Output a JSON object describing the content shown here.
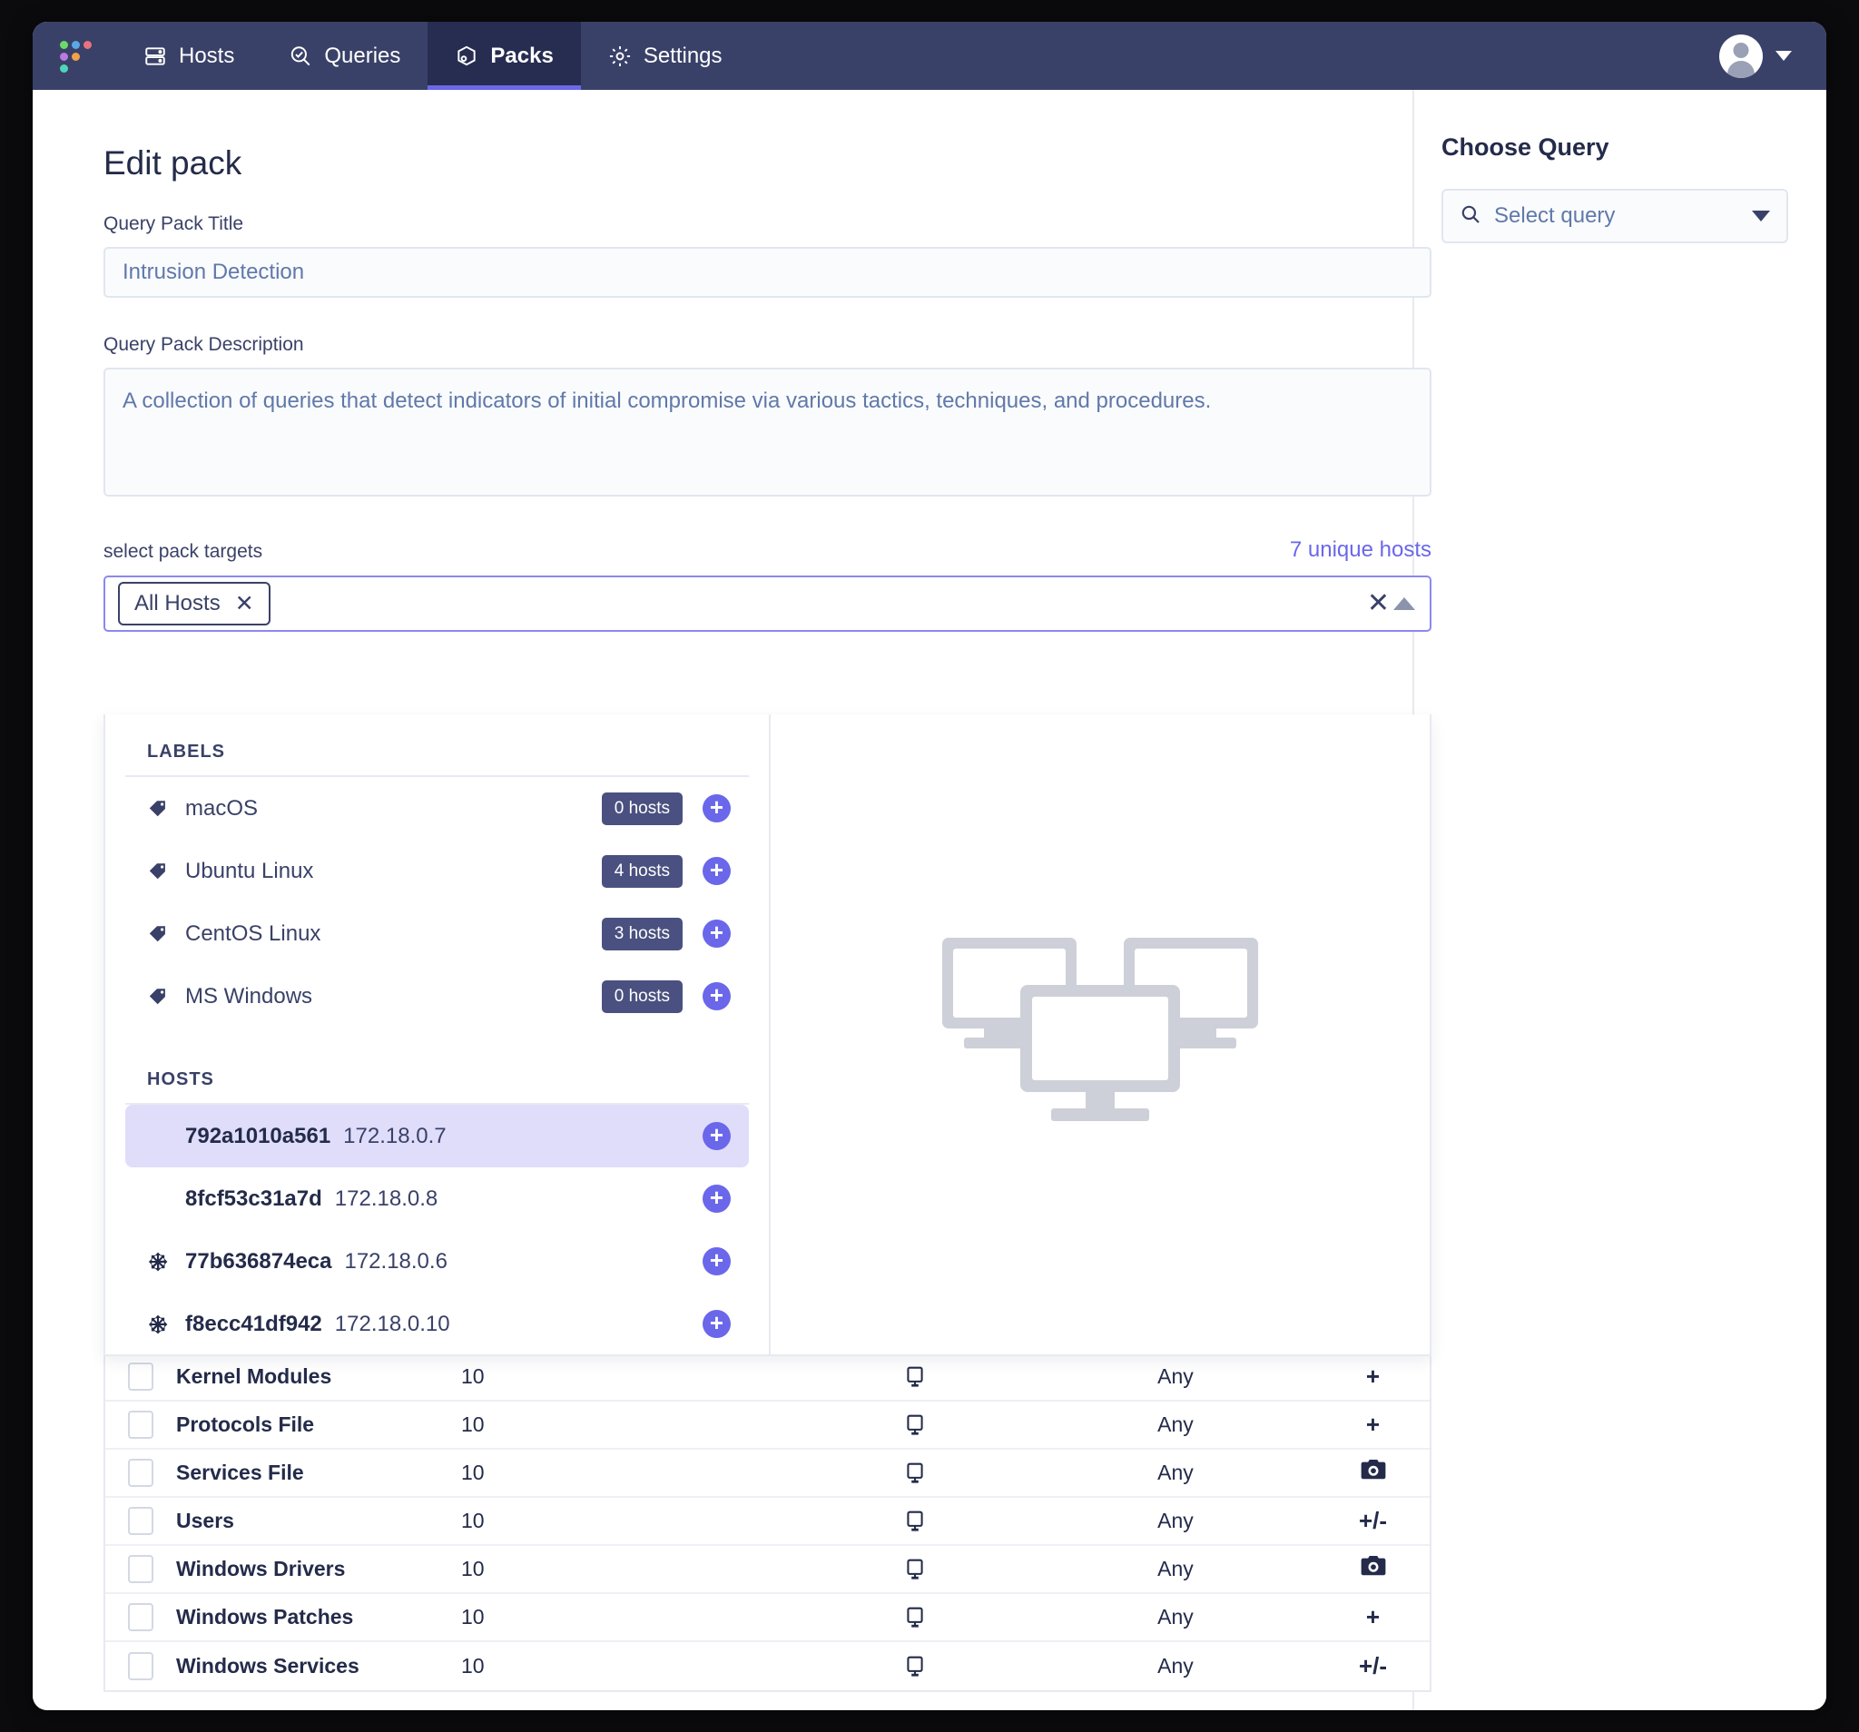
{
  "nav": {
    "logo_name": "fleet-dots-logo",
    "items": [
      {
        "label": "Hosts",
        "icon": "server-icon",
        "active": false
      },
      {
        "label": "Queries",
        "icon": "magnifier-check-icon",
        "active": false
      },
      {
        "label": "Packs",
        "icon": "pack-box-icon",
        "active": true
      },
      {
        "label": "Settings",
        "icon": "gear-icon",
        "active": false
      }
    ],
    "avatar_icon": "user-avatar",
    "avatar_caret_icon": "chevron-down-icon"
  },
  "page": {
    "title": "Edit pack",
    "title_field": {
      "label": "Query Pack Title",
      "value": "Intrusion Detection"
    },
    "description_field": {
      "label": "Query Pack Description",
      "value": "A collection of queries that detect indicators of initial compromise via various tactics, techniques, and procedures."
    },
    "targets": {
      "label": "select pack targets",
      "unique_hosts": "7 unique hosts",
      "chips": [
        {
          "label": "All Hosts",
          "remove_icon": "close-icon"
        }
      ],
      "clear_icon": "close-icon",
      "collapse_icon": "chevron-up-icon"
    }
  },
  "dropdown": {
    "labels_header": "LABELS",
    "labels": [
      {
        "name": "macOS",
        "count": "0 hosts",
        "icon": "tag-icon",
        "add_icon": "plus-circle-icon"
      },
      {
        "name": "Ubuntu Linux",
        "count": "4 hosts",
        "icon": "tag-icon",
        "add_icon": "plus-circle-icon"
      },
      {
        "name": "CentOS Linux",
        "count": "3 hosts",
        "icon": "tag-icon",
        "add_icon": "plus-circle-icon"
      },
      {
        "name": "MS Windows",
        "count": "0 hosts",
        "icon": "tag-icon",
        "add_icon": "plus-circle-icon"
      }
    ],
    "hosts_header": "HOSTS",
    "hosts": [
      {
        "id": "792a1010a561",
        "ip": "172.18.0.7",
        "os_icon": "none",
        "selected": true,
        "add_icon": "plus-circle-icon"
      },
      {
        "id": "8fcf53c31a7d",
        "ip": "172.18.0.8",
        "os_icon": "none",
        "selected": false,
        "add_icon": "plus-circle-icon"
      },
      {
        "id": "77b636874eca",
        "ip": "172.18.0.6",
        "os_icon": "centos-icon",
        "selected": false,
        "add_icon": "plus-circle-icon"
      },
      {
        "id": "f8ecc41df942",
        "ip": "172.18.0.10",
        "os_icon": "centos-icon",
        "selected": false,
        "add_icon": "plus-circle-icon"
      }
    ],
    "preview_icon": "monitors-illustration"
  },
  "pack_table": {
    "rows": [
      {
        "name": "Kernel Modules",
        "interval": "10",
        "platform_icon": "desktop-icon",
        "version": "Any",
        "mode": "+",
        "checked": false
      },
      {
        "name": "Protocols File",
        "interval": "10",
        "platform_icon": "desktop-icon",
        "version": "Any",
        "mode": "+",
        "checked": false
      },
      {
        "name": "Services File",
        "interval": "10",
        "platform_icon": "desktop-icon",
        "version": "Any",
        "mode": "camera-icon",
        "checked": false
      },
      {
        "name": "Users",
        "interval": "10",
        "platform_icon": "desktop-icon",
        "version": "Any",
        "mode": "+/-",
        "checked": false
      },
      {
        "name": "Windows Drivers",
        "interval": "10",
        "platform_icon": "desktop-icon",
        "version": "Any",
        "mode": "camera-icon",
        "checked": false
      },
      {
        "name": "Windows Patches",
        "interval": "10",
        "platform_icon": "desktop-icon",
        "version": "Any",
        "mode": "+",
        "checked": false
      },
      {
        "name": "Windows Services",
        "interval": "10",
        "platform_icon": "desktop-icon",
        "version": "Any",
        "mode": "+/-",
        "checked": false
      }
    ]
  },
  "sidebar": {
    "title": "Choose Query",
    "select_query": {
      "placeholder": "Select query",
      "search_icon": "search-icon",
      "caret_icon": "chevron-down-icon"
    }
  },
  "colors": {
    "nav_bg": "#3a4168",
    "nav_active_bg": "#272c51",
    "accent": "#6a67ea",
    "text_dark": "#242b4a",
    "text_mid": "#3a4168",
    "input_text": "#5f79ab",
    "badge_bg": "#4a5180",
    "selected_row": "#e0ddfa"
  }
}
